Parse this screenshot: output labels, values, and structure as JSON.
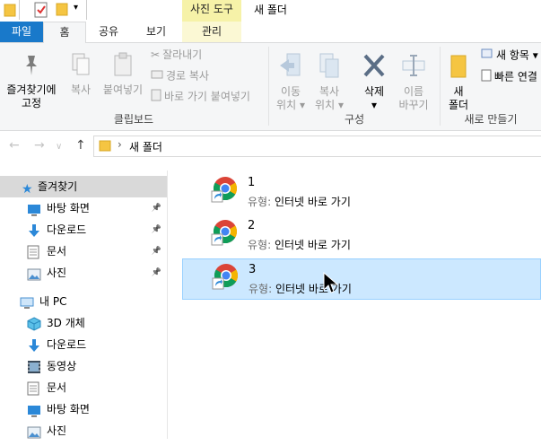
{
  "window": {
    "title": "새 폴더",
    "contextual_tab_header": "사진 도구"
  },
  "ribbon_tabs": {
    "file": "파일",
    "home": "홈",
    "share": "공유",
    "view": "보기",
    "manage": "관리"
  },
  "ribbon": {
    "clipboard": {
      "pin_line1": "즐겨찾기에",
      "pin_line2": "고정",
      "copy": "복사",
      "paste": "붙여넣기",
      "cut": "잘라내기",
      "copy_path": "경로 복사",
      "paste_shortcut": "바로 가기 붙여넣기",
      "group_label": "클립보드"
    },
    "organize": {
      "move_line1": "이동",
      "move_line2": "위치",
      "copyto_line1": "복사",
      "copyto_line2": "위치",
      "delete": "삭제",
      "rename_line1": "이름",
      "rename_line2": "바꾸기",
      "group_label": "구성"
    },
    "new": {
      "folder_line1": "새",
      "folder_line2": "폴더",
      "new_item": "새 항목",
      "easy_access": "빠른 연결",
      "group_label": "새로 만들기"
    }
  },
  "address_bar": {
    "crumb": "새 폴더"
  },
  "nav_pane": {
    "quick_access": {
      "label": "즐겨찾기",
      "items": [
        {
          "label": "바탕 화면",
          "icon": "desktop-icon"
        },
        {
          "label": "다운로드",
          "icon": "download-icon"
        },
        {
          "label": "문서",
          "icon": "document-icon"
        },
        {
          "label": "사진",
          "icon": "pictures-icon"
        }
      ]
    },
    "this_pc": {
      "label": "내 PC",
      "items": [
        {
          "label": "3D 개체",
          "icon": "3d-objects-icon"
        },
        {
          "label": "다운로드",
          "icon": "download-icon"
        },
        {
          "label": "동영상",
          "icon": "video-icon"
        },
        {
          "label": "문서",
          "icon": "document-icon"
        },
        {
          "label": "바탕 화면",
          "icon": "desktop-icon"
        },
        {
          "label": "사진",
          "icon": "pictures-icon"
        }
      ]
    }
  },
  "files": [
    {
      "name": "1",
      "type_key": "유형:",
      "type_value": "인터넷 바로 가기"
    },
    {
      "name": "2",
      "type_key": "유형:",
      "type_value": "인터넷 바로 가기"
    },
    {
      "name": "3",
      "type_key": "유형:",
      "type_value": "인터넷 바로 가기"
    }
  ],
  "colors": {
    "file_tab": "#1979ca",
    "contextual_tab": "#f6f2a8",
    "selection": "#cce8ff",
    "folder": "#f5c542"
  }
}
